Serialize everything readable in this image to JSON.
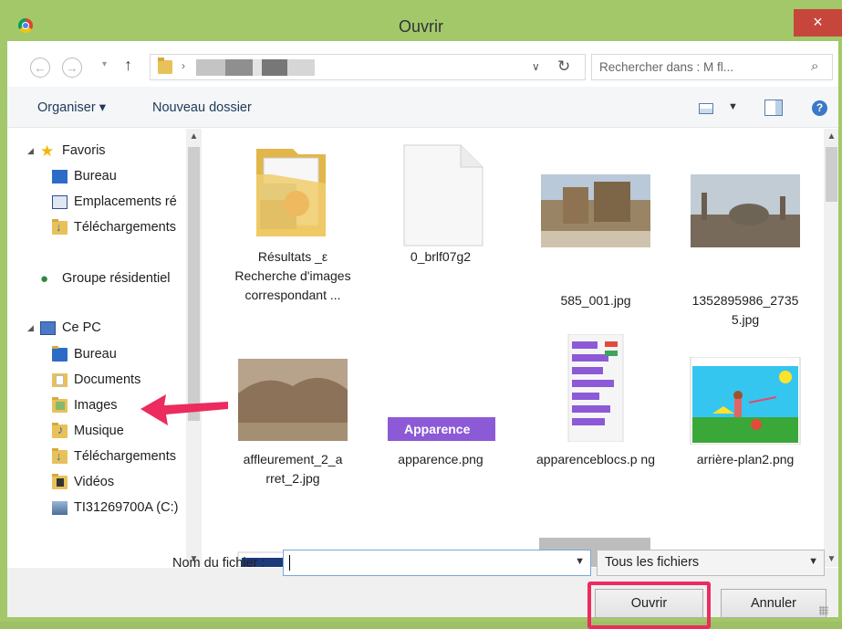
{
  "window": {
    "title": "Ouvrir",
    "close_glyph": "×"
  },
  "address": {
    "back_glyph": "←",
    "forward_glyph": "→",
    "up_glyph": "↑",
    "dropdown_glyph": "∨",
    "refresh_glyph": "↻",
    "search_placeholder": "Rechercher dans : M        fl...",
    "search_glyph": "⌕"
  },
  "toolbar": {
    "organise": "Organiser ▾",
    "new_folder": "Nouveau dossier",
    "help_glyph": "?"
  },
  "nav": {
    "favorites": "Favoris",
    "fav_items": [
      "Bureau",
      "Emplacements ré",
      "Téléchargements"
    ],
    "homegroup": "Groupe résidentiel",
    "pc": "Ce PC",
    "pc_items": [
      "Bureau",
      "Documents",
      "Images",
      "Musique",
      "Téléchargements",
      "Vidéos",
      "TI31269700A (C:)"
    ]
  },
  "files": [
    {
      "name": "Résultats     _ε Recherche d'images correspondant ...",
      "icon": "image-folder"
    },
    {
      "name": "0_brlf07g2",
      "icon": "blank-file"
    },
    {
      "name": "585_001.jpg",
      "icon": "photo-citadel"
    },
    {
      "name": "1352895986_2735 5.jpg",
      "icon": "photo-city"
    },
    {
      "name": "affleurement_2_a rret_2.jpg",
      "icon": "photo-rock"
    },
    {
      "name": "apparence.png",
      "icon": "apparence-button",
      "thumb_text": "Apparence"
    },
    {
      "name": "apparenceblocs.p ng",
      "icon": "scratch-blocks"
    },
    {
      "name": "arrière-plan2.png",
      "icon": "scratch-stage"
    }
  ],
  "footer": {
    "filename_label": "Nom du fichier :",
    "filename_value": "",
    "filetype": "Tous les fichiers",
    "open_button": "Ouvrir",
    "cancel_button": "Annuler"
  },
  "colors": {
    "frame": "#a2c86a",
    "close": "#c7463b",
    "highlight": "#ec2b5f",
    "link": "#1e395b"
  }
}
